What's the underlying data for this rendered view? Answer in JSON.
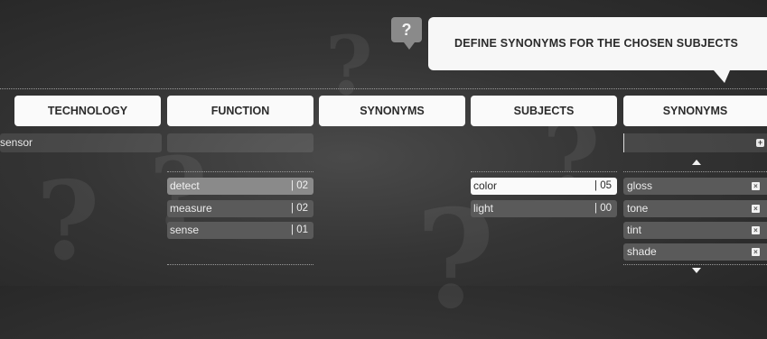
{
  "help": {
    "label": "?"
  },
  "instruction": "DEFINE SYNONYMS FOR THE CHOSEN SUBJECTS",
  "columns": {
    "technology": "TECHNOLOGY",
    "function": "FUNCTION",
    "synonyms1": "SYNONYMS",
    "subjects": "SUBJECTS",
    "synonyms2": "SYNONYMS"
  },
  "technology_input": {
    "value": "sensor"
  },
  "function_items": [
    {
      "label": "detect",
      "count": "| 02"
    },
    {
      "label": "measure",
      "count": "| 02"
    },
    {
      "label": "sense",
      "count": "| 01"
    }
  ],
  "subject_items": [
    {
      "label": "color",
      "count": "| 05"
    },
    {
      "label": "light",
      "count": "| 00"
    }
  ],
  "synonym_items": [
    {
      "label": "gloss"
    },
    {
      "label": "tone"
    },
    {
      "label": "tint"
    },
    {
      "label": "shade"
    }
  ],
  "icons": {
    "add": "plus-icon",
    "remove": "close-icon",
    "scroll_up": "arrow-up-icon",
    "scroll_down": "arrow-down-icon"
  }
}
